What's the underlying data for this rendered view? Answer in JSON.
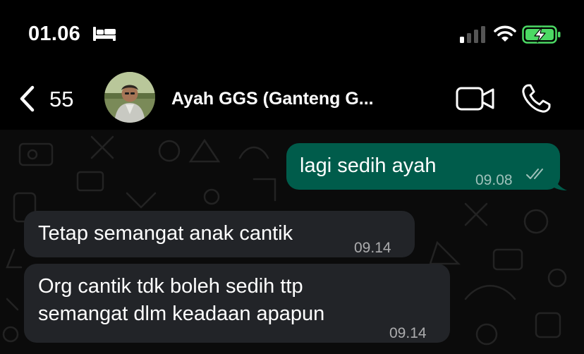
{
  "status_bar": {
    "time": "01.06",
    "icons": [
      "bed-icon",
      "signal-icon",
      "wifi-icon",
      "battery-charging-icon"
    ]
  },
  "header": {
    "back_count": "55",
    "contact_name": "Ayah GGS (Ganteng G...",
    "icons": [
      "chevron-left-icon",
      "video-camera-icon",
      "phone-icon"
    ]
  },
  "messages": [
    {
      "direction": "outgoing",
      "text": "lagi sedih ayah",
      "time": "09.08",
      "status": "read"
    },
    {
      "direction": "incoming",
      "text": "Tetap semangat anak cantik",
      "time": "09.14"
    },
    {
      "direction": "incoming",
      "lines": [
        "Org cantik tdk boleh sedih ttp",
        "semangat dlm keadaan apapun"
      ],
      "time": "09.14"
    }
  ],
  "colors": {
    "outgoing_bubble": "#005c4b",
    "incoming_bubble": "#222428",
    "background": "#0b0b0b",
    "battery": "#4cd964"
  }
}
